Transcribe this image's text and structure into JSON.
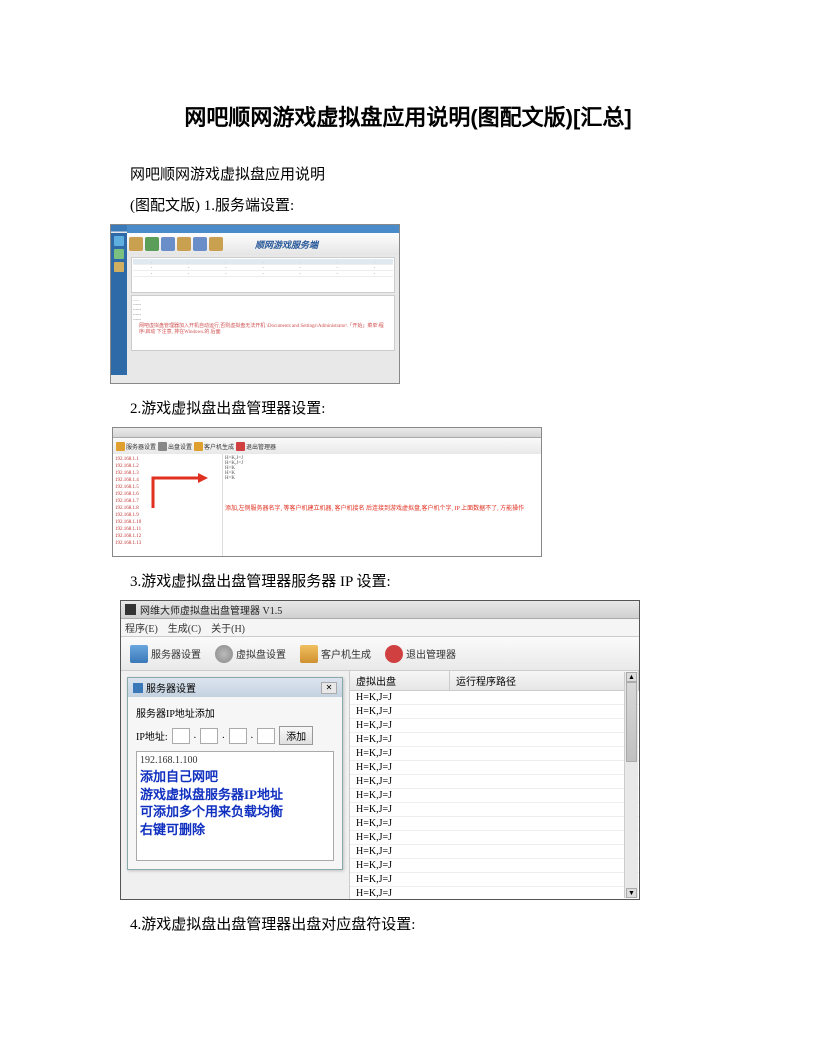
{
  "title": "网吧顺网游戏虚拟盘应用说明(图配文版)[汇总]",
  "intro_line1": "网吧顺网游戏虚拟盘应用说明",
  "intro_line2": "(图配文版) 1.服务端设置:",
  "section2": "2.游戏虚拟盘出盘管理器设置:",
  "section3": "3.游戏虚拟盘出盘管理器服务器 IP 设置:",
  "section4": "4.游戏虚拟盘出盘管理器出盘对应盘符设置:",
  "s1": {
    "banner": "顺网游戏服务端",
    "warn": "网吧虚拟盘管理器加入开机自动运行,否则虚拟盘无法开机\n\\Documents and Settings\\Administrator\\「开始」菜单\\程序\\启动\n下注意, 排在Windows.的.后面"
  },
  "s2": {
    "tool": {
      "srv": "服务器设置",
      "disk": "出盘设置",
      "cli": "客户机生成",
      "exit": "退出管理器"
    },
    "nodes": [
      "192.168.1.1",
      "192.168.1.2",
      "192.168.1.3",
      "192.168.1.4",
      "192.168.1.5",
      "192.168.1.6",
      "192.168.1.7",
      "192.168.1.8",
      "192.168.1.9",
      "192.168.1.10",
      "192.168.1.11",
      "192.168.1.12",
      "192.168.1.13"
    ],
    "items": [
      "H=K,J=J",
      "H=K,J=J",
      "H=K",
      "",
      "H=K",
      "H=K",
      "",
      "",
      "",
      "",
      "",
      "",
      ""
    ],
    "callout": "添加,左侧服务器名字, 等客户机建立机器, 客户机接名\n后连接到游戏虚拟盘,客户机个字, IP 上面数据不了, 方能操作"
  },
  "s3": {
    "win_title": "网维大师虚拟盘出盘管理器 V1.5",
    "menu": [
      "程序(E)",
      "生成(C)",
      "关于(H)"
    ],
    "tb": {
      "srv": "服务器设置",
      "disk": "虚拟盘设置",
      "cli": "客户机生成",
      "exit": "退出管理器"
    },
    "dlg_title": "服务器设置",
    "dlg_label1": "服务器IP地址添加",
    "ip_label": "IP地址:",
    "add_btn": "添加",
    "ip_list": "192.168.1.100",
    "help": [
      "添加自己网吧",
      "游戏虚拟盘服务器IP地址",
      "可添加多个用来负载均衡",
      "右键可删除"
    ],
    "cols": [
      "虚拟出盘",
      "运行程序路径"
    ],
    "rows": [
      "H=K,J=J",
      "H=K,J=J",
      "H=K,J=J",
      "H=K,J=J",
      "H=K,J=J",
      "H=K,J=J",
      "H=K,J=J",
      "H=K,J=J",
      "H=K,J=J",
      "H=K,J=J",
      "H=K,J=J",
      "H=K,J=J",
      "H=K,J=J",
      "H=K,J=J",
      "H=K,J=J"
    ]
  }
}
